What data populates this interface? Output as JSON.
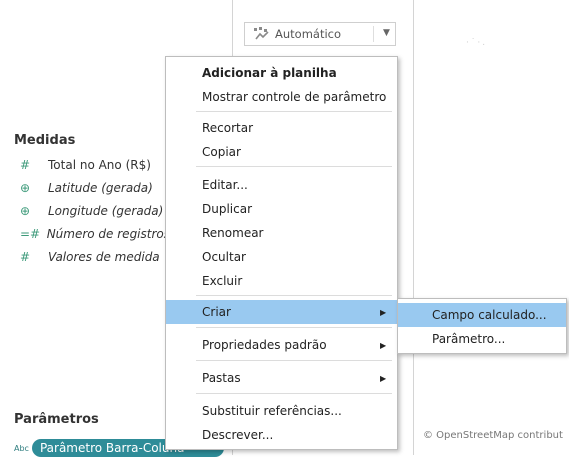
{
  "marks_card": {
    "mark_type": "Automático"
  },
  "measures": {
    "title": "Medidas",
    "items": [
      {
        "label": "Total no Ano (R$)",
        "italic": false,
        "icon": "#"
      },
      {
        "label": "Latitude (gerada)",
        "italic": true,
        "icon": "⊕"
      },
      {
        "label": "Longitude (gerada)",
        "italic": true,
        "icon": "⊕"
      },
      {
        "label": "Número de registros",
        "italic": true,
        "icon": "=#"
      },
      {
        "label": "Valores de medida",
        "italic": true,
        "icon": "#"
      }
    ]
  },
  "parameters": {
    "title": "Parâmetros",
    "type_badge": "Abc",
    "pill_label": "Parâmetro Barra-Coluna"
  },
  "map": {
    "attribution": "© OpenStreetMap contribut"
  },
  "context_menu": {
    "add_to_sheet": "Adicionar à planilha",
    "show_parameter_control": "Mostrar controle de parâmetro",
    "cut": "Recortar",
    "copy": "Copiar",
    "edit": "Editar...",
    "duplicate": "Duplicar",
    "rename": "Renomear",
    "hide": "Ocultar",
    "delete": "Excluir",
    "create": "Criar",
    "default_properties": "Propriedades padrão",
    "folders": "Pastas",
    "replace_references": "Substituir referências...",
    "describe": "Descrever..."
  },
  "submenu": {
    "calculated_field": "Campo calculado...",
    "parameter": "Parâmetro..."
  },
  "colors": {
    "highlight": "#99c9f0",
    "measure_icon": "#3d9a7a",
    "parameter_pill": "#2e8c98"
  }
}
